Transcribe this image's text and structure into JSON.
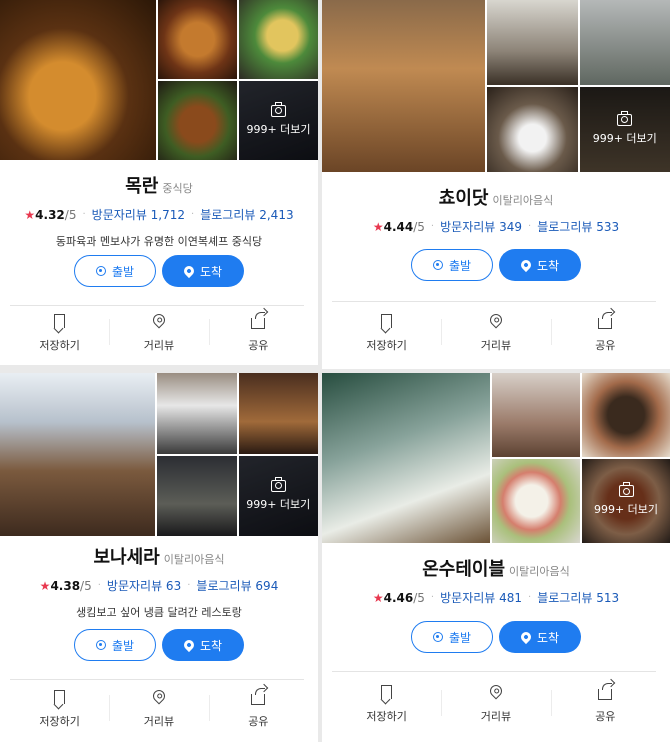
{
  "cards": [
    {
      "name": "목란",
      "category": "중식당",
      "rating": "4.32",
      "rating_max": "/5",
      "visitor_review_label": "방문자리뷰 1,712",
      "blog_review_label": "블로그리뷰 2,413",
      "description": "동파육과 멘보샤가 유명한 이연복셰프 중식당",
      "more_photos": "999+ 더보기",
      "btn_depart": "출발",
      "btn_arrive": "도착",
      "action_save": "저장하기",
      "action_distance": "거리뷰",
      "action_share": "공유"
    },
    {
      "name": "쵸이닷",
      "category": "이탈리아음식",
      "rating": "4.44",
      "rating_max": "/5",
      "visitor_review_label": "방문자리뷰 349",
      "blog_review_label": "블로그리뷰 533",
      "description": "",
      "more_photos": "999+ 더보기",
      "btn_depart": "출발",
      "btn_arrive": "도착",
      "action_save": "저장하기",
      "action_distance": "거리뷰",
      "action_share": "공유"
    },
    {
      "name": "보나세라",
      "category": "이탈리아음식",
      "rating": "4.38",
      "rating_max": "/5",
      "visitor_review_label": "방문자리뷰 63",
      "blog_review_label": "블로그리뷰 694",
      "description": "생킴보고 싶어 냉큼 달려간 레스토랑",
      "more_photos": "999+ 더보기",
      "btn_depart": "출발",
      "btn_arrive": "도착",
      "action_save": "저장하기",
      "action_distance": "거리뷰",
      "action_share": "공유"
    },
    {
      "name": "온수테이블",
      "category": "이탈리아음식",
      "rating": "4.46",
      "rating_max": "/5",
      "visitor_review_label": "방문자리뷰 481",
      "blog_review_label": "블로그리뷰 513",
      "description": "",
      "more_photos": "999+ 더보기",
      "btn_depart": "출발",
      "btn_arrive": "도착",
      "action_save": "저장하기",
      "action_distance": "거리뷰",
      "action_share": "공유"
    }
  ],
  "colors": {
    "primary": "#1f7cf0",
    "star": "#e8384f",
    "link": "#1a5ab8"
  }
}
